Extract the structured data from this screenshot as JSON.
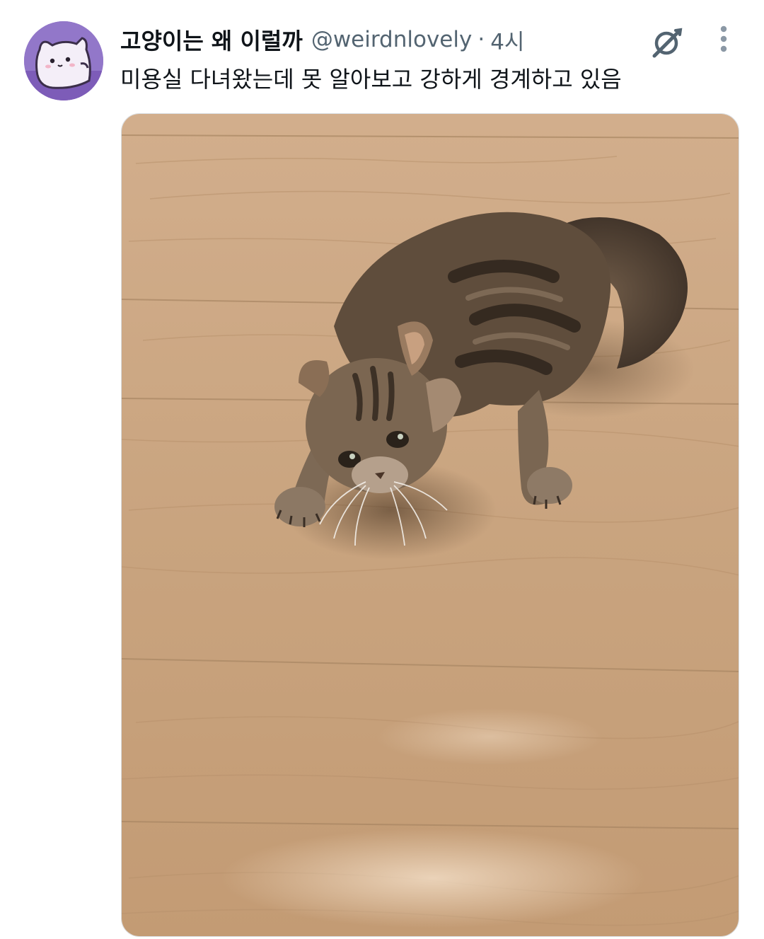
{
  "post": {
    "author": {
      "display_name": "고양이는 왜 이럴까",
      "handle": "@weirdnlovely",
      "avatar_icon": "cat-cartoon-avatar"
    },
    "separator": "·",
    "time": "4시",
    "text": "미용실 다녀왔는데 못 알아보고 강하게 경계하고 있음",
    "media": {
      "kind": "photo",
      "subject": "kitten-on-wood-floor"
    },
    "actions": {
      "grok_icon": "grok-icon",
      "more_icon": "more-vertical-icon"
    }
  },
  "colors": {
    "text_primary": "#0f1419",
    "text_secondary": "#536471",
    "avatar_bg": "#8a6ac4",
    "floor": "#c9a47f"
  }
}
